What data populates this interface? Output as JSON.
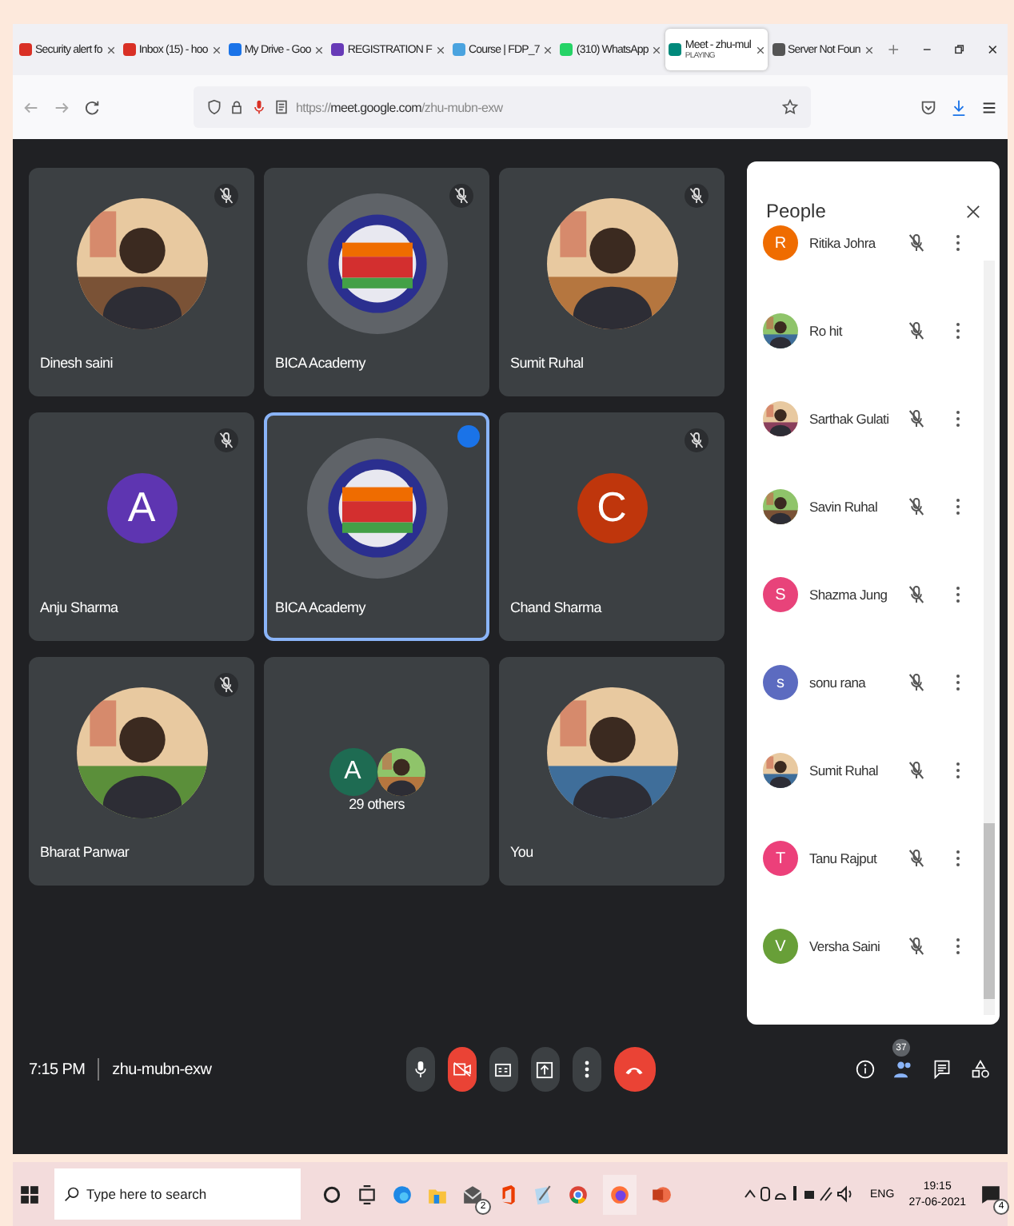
{
  "tabs": [
    {
      "kind": "gmail",
      "label": "Security alert fo",
      "selected": false
    },
    {
      "kind": "gmail",
      "label": "Inbox (15) - hoo",
      "selected": false
    },
    {
      "kind": "drive",
      "label": "My Drive - Goo",
      "selected": false
    },
    {
      "kind": "form",
      "label": "REGISTRATION F",
      "selected": false
    },
    {
      "kind": "globe",
      "label": "Course | FDP_7",
      "selected": false
    },
    {
      "kind": "whatsapp",
      "label": "(310) WhatsApp",
      "selected": false
    },
    {
      "kind": "meet",
      "label": "Meet - zhu-mul",
      "sublabel": "PLAYING",
      "selected": true
    },
    {
      "kind": "info",
      "label": "Server Not Foun",
      "selected": false
    }
  ],
  "address": "https://**meet.google.com**/zhu-mubn-exw",
  "tiles": [
    {
      "name": "Dinesh saini",
      "muted": true,
      "speaking": false
    },
    {
      "name": "BICA Academy",
      "kind": "logo",
      "muted": true,
      "speaking": false
    },
    {
      "name": "Sumit Ruhal",
      "muted": true,
      "speaking": false
    },
    {
      "name": "Anju Sharma",
      "kind": "letter",
      "letter": "A",
      "color": "#5e35b1",
      "muted": true,
      "speaking": false
    },
    {
      "name": "BICA Academy",
      "kind": "logo",
      "muted": false,
      "speaking": true
    },
    {
      "name": "Chand Sharma",
      "kind": "letter",
      "letter": "C",
      "color": "#bf360c",
      "muted": true,
      "speaking": false
    },
    {
      "name": "Bharat Panwar",
      "muted": true,
      "speaking": false
    },
    {
      "name": "29 others",
      "kind": "group",
      "letter": "A",
      "color": "#1e6b52",
      "muted": false,
      "speaking": false
    },
    {
      "name": "You",
      "muted": false,
      "speaking": false
    }
  ],
  "people": {
    "title": "People",
    "items": [
      {
        "name": "Ritika Johra",
        "kind": "letter",
        "letter": "R",
        "color": "#ef6c00"
      },
      {
        "name": "Ro hit"
      },
      {
        "name": "Sarthak Gulati"
      },
      {
        "name": "Savin Ruhal"
      },
      {
        "name": "Shazma Jung",
        "kind": "letter",
        "letter": "S",
        "color": "#e8437a"
      },
      {
        "name": "sonu rana",
        "kind": "letter",
        "letter": "s",
        "color": "#5c6bc0"
      },
      {
        "name": "Sumit Ruhal"
      },
      {
        "name": "Tanu Rajput",
        "kind": "letter",
        "letter": "T",
        "color": "#ec407a"
      },
      {
        "name": "Versha Saini",
        "kind": "letter",
        "letter": "V",
        "color": "#689f38"
      }
    ]
  },
  "meeting": {
    "time": "7:15 PM",
    "code": "zhu-mubn-exw",
    "participants": "37"
  },
  "taskbar": {
    "search_placeholder": "Type here to search",
    "mail_badge": "2",
    "language": "ENG",
    "time": "19:15",
    "date": "27-06-2021",
    "notifications": "4"
  }
}
